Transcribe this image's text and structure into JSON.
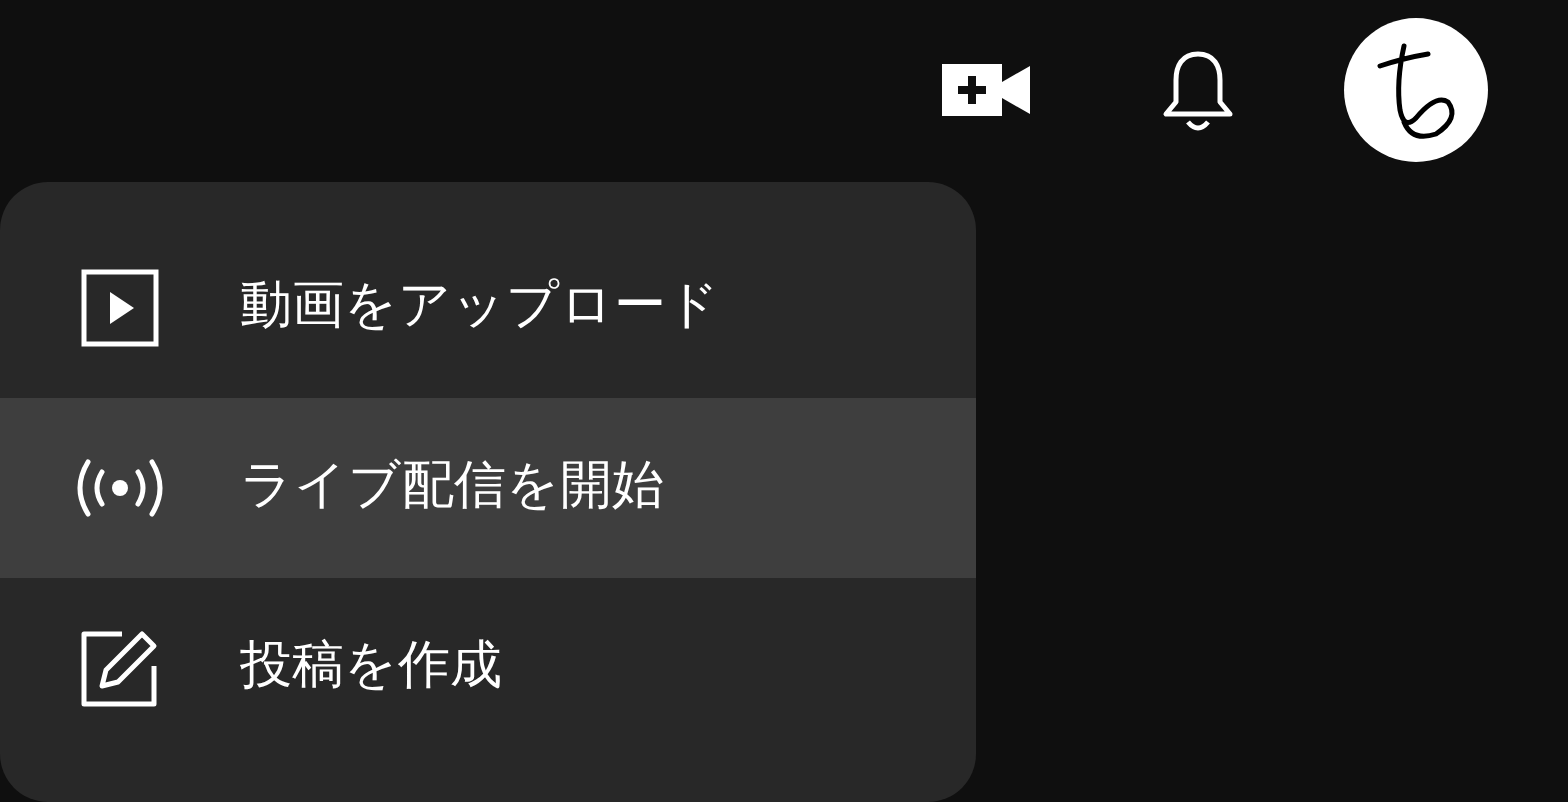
{
  "top_bar": {
    "icons": [
      {
        "kind": "create"
      },
      {
        "kind": "notifications"
      },
      {
        "kind": "avatar"
      }
    ]
  },
  "menu": {
    "items": [
      {
        "kind": "upload",
        "label": "動画をアップロード",
        "selected": false
      },
      {
        "kind": "live",
        "label": "ライブ配信を開始",
        "selected": true
      },
      {
        "kind": "post",
        "label": "投稿を作成",
        "selected": false
      }
    ]
  }
}
